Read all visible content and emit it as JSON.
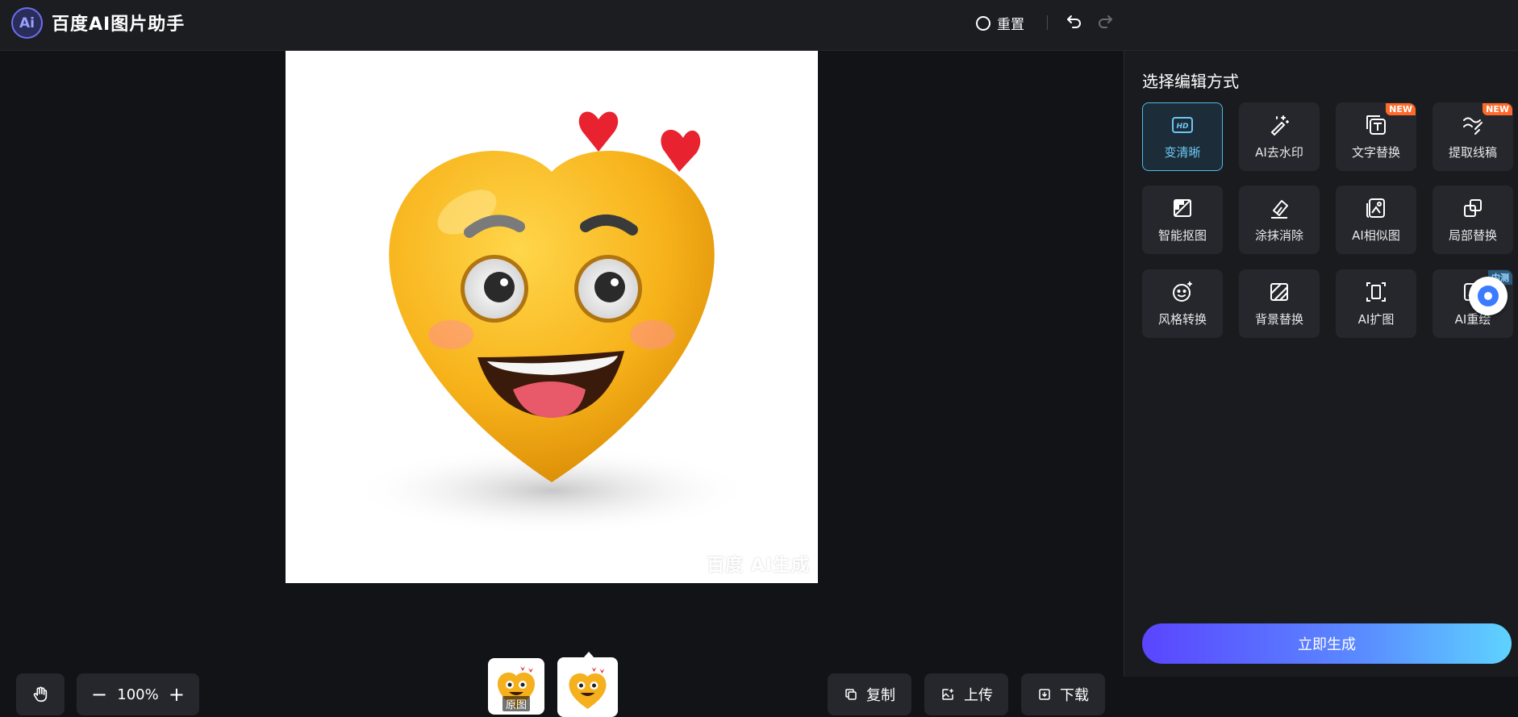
{
  "header": {
    "logo_text": "Ai",
    "title": "百度AI图片助手",
    "reset_label": "重置",
    "undo_icon": "undo-icon",
    "redo_icon": "redo-icon"
  },
  "canvas": {
    "watermark": "百度 AI生成",
    "zoom": "100%",
    "zoom_minus": "−",
    "zoom_plus": "+",
    "thumbnails": [
      {
        "tag": "原图"
      },
      {
        "tag": ""
      }
    ],
    "actions": {
      "copy": "复制",
      "upload": "上传",
      "download": "下载"
    }
  },
  "panel": {
    "title": "选择编辑方式",
    "tools": [
      {
        "label": "变清晰",
        "icon": "hd-icon",
        "badge": ""
      },
      {
        "label": "AI去水印",
        "icon": "magic-wand-icon",
        "badge": ""
      },
      {
        "label": "文字替换",
        "icon": "text-replace-icon",
        "badge": "NEW"
      },
      {
        "label": "提取线稿",
        "icon": "line-art-icon",
        "badge": "NEW"
      },
      {
        "label": "智能抠图",
        "icon": "cutout-icon",
        "badge": ""
      },
      {
        "label": "涂抹消除",
        "icon": "eraser-icon",
        "badge": ""
      },
      {
        "label": "AI相似图",
        "icon": "similar-image-icon",
        "badge": ""
      },
      {
        "label": "局部替换",
        "icon": "partial-replace-icon",
        "badge": ""
      },
      {
        "label": "风格转换",
        "icon": "style-icon",
        "badge": ""
      },
      {
        "label": "背景替换",
        "icon": "background-icon",
        "badge": ""
      },
      {
        "label": "AI扩图",
        "icon": "expand-icon",
        "badge": ""
      },
      {
        "label": "AI重绘",
        "icon": "redraw-icon",
        "badge": "内测"
      }
    ],
    "generate_label": "立即生成"
  },
  "colors": {
    "accent": "#53b8e8",
    "badge_new": "#ff6a2b",
    "generate_start": "#5a45ff",
    "generate_end": "#5ed3ff"
  }
}
